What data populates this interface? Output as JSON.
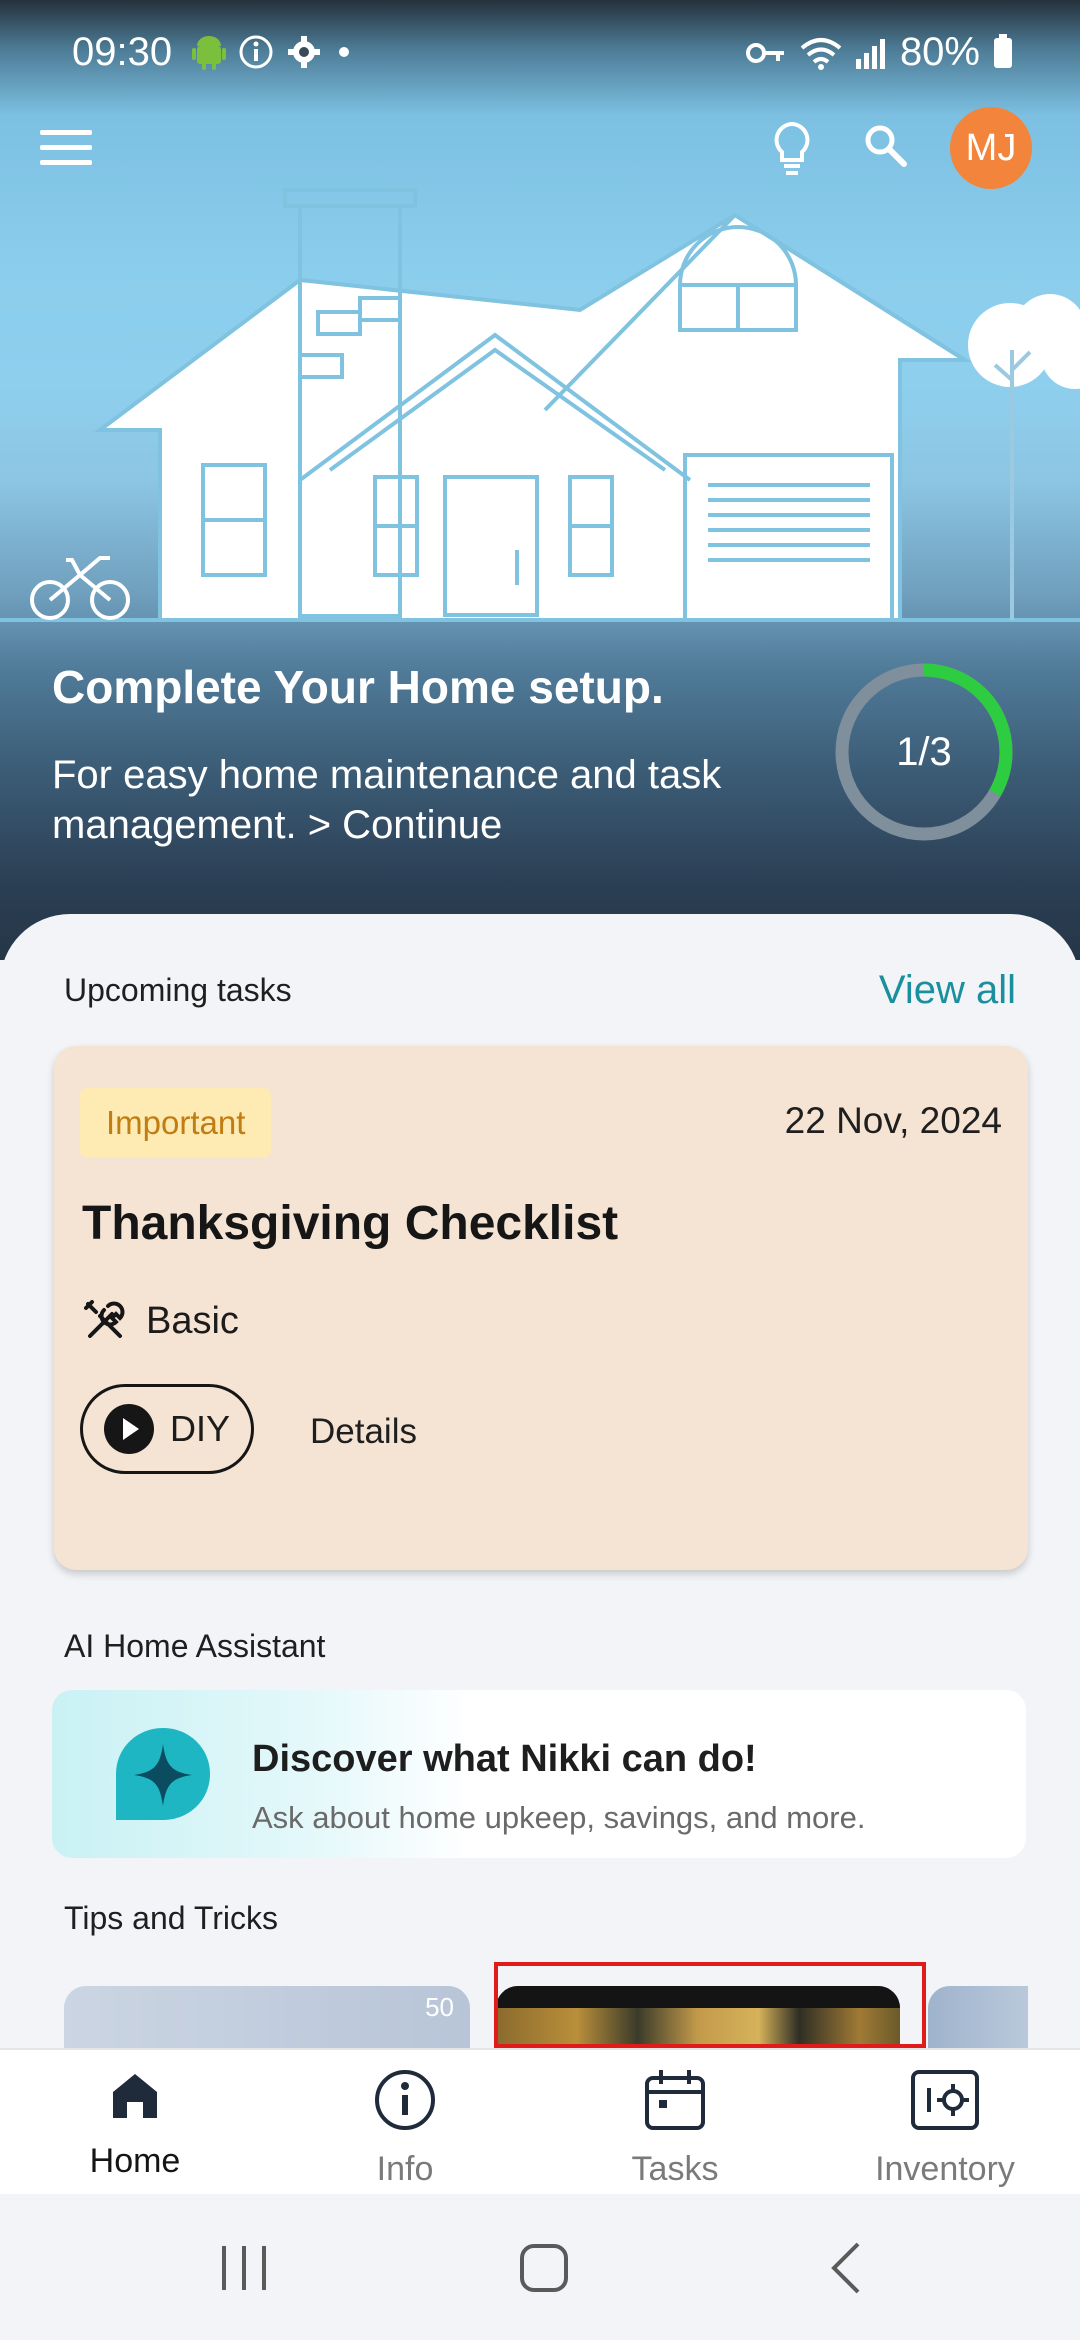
{
  "status_bar": {
    "time": "09:30",
    "battery": "80%"
  },
  "header": {
    "avatar_initials": "MJ"
  },
  "setup": {
    "title": "Complete Your Home setup.",
    "subtitle": "For easy home maintenance and task management. > Continue",
    "progress_label": "1/3",
    "progress_fraction": 0.3333
  },
  "upcoming": {
    "section_label": "Upcoming tasks",
    "view_all": "View all",
    "task": {
      "badge": "Important",
      "date": "22 Nov, 2024",
      "title": "Thanksgiving Checklist",
      "level": "Basic",
      "diy_label": "DIY",
      "details_label": "Details"
    }
  },
  "ai_assistant": {
    "section_label": "AI Home Assistant",
    "title": "Discover what Nikki can do!",
    "subtitle": "Ask about home upkeep, savings, and more."
  },
  "tips": {
    "section_label": "Tips and Tricks",
    "card1_temp": "50"
  },
  "tabs": [
    {
      "label": "Home",
      "icon": "home-icon"
    },
    {
      "label": "Info",
      "icon": "info-icon"
    },
    {
      "label": "Tasks",
      "icon": "calendar-icon"
    },
    {
      "label": "Inventory",
      "icon": "inventory-icon"
    }
  ],
  "colors": {
    "accent": "#1a8f9e",
    "avatar": "#f2843b",
    "progress": "#2ecc40",
    "highlight": "#e11a1a"
  }
}
